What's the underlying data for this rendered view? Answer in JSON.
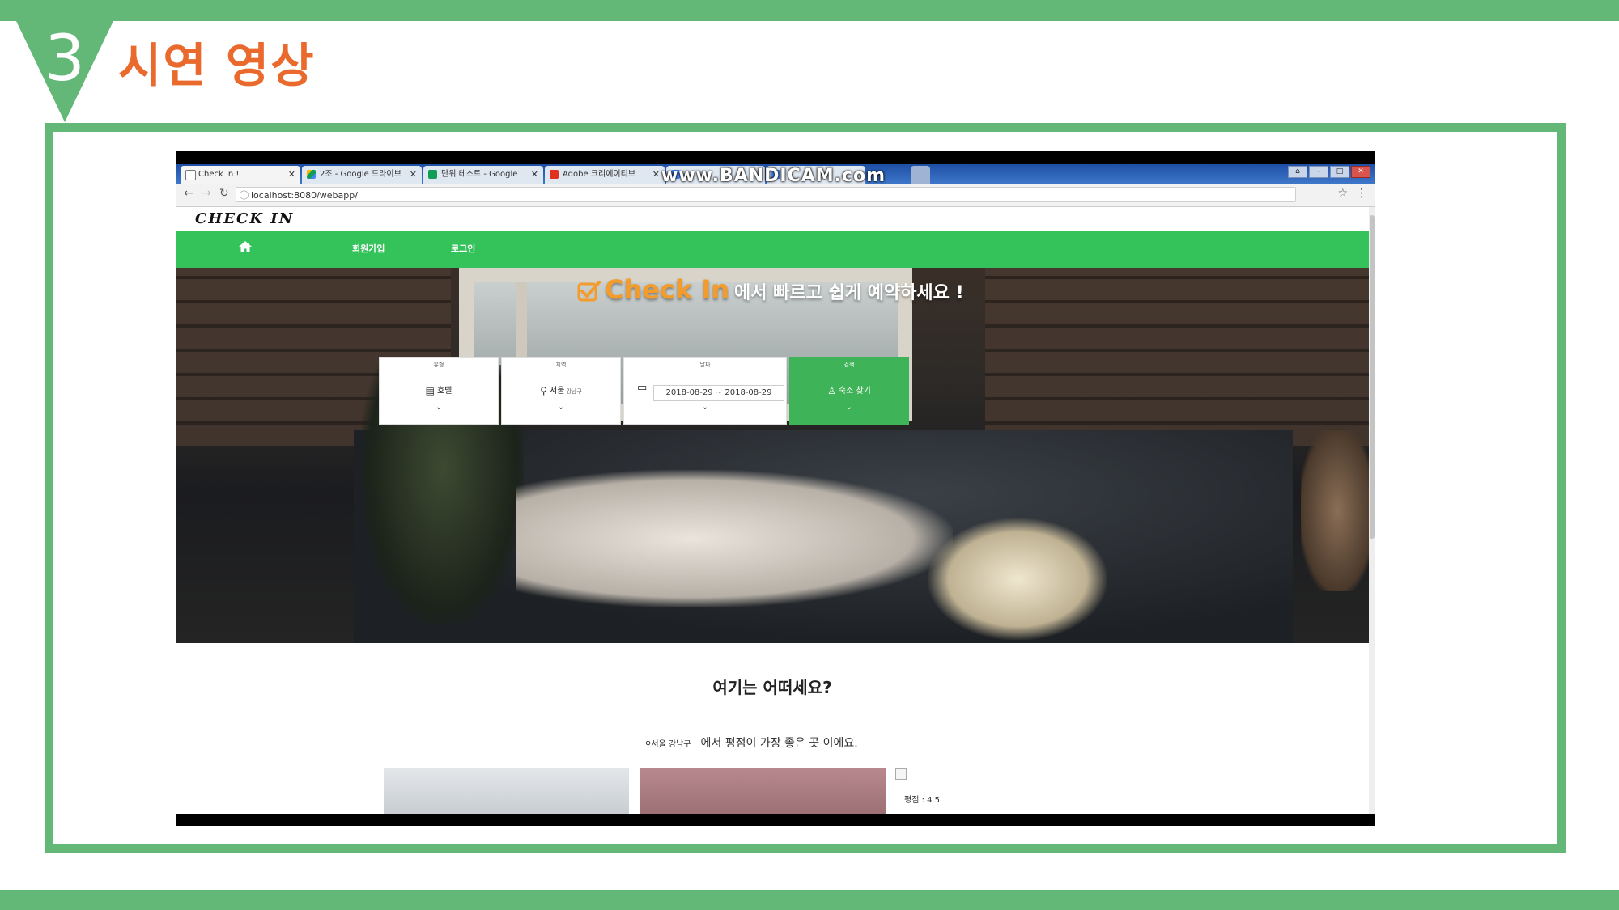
{
  "slide": {
    "number": "3",
    "title": "시연 영상",
    "colors": {
      "accent_green": "#63b877",
      "title_orange": "#ea6a2e"
    }
  },
  "browser": {
    "tabs": [
      {
        "label": "Check In !",
        "favicon": "page-icon"
      },
      {
        "label": "2조 - Google 드라이브",
        "favicon": "google-drive-icon"
      },
      {
        "label": "단위 테스트 - Google",
        "favicon": "google-sheets-icon"
      },
      {
        "label": "Adobe 크리에이티브 ",
        "favicon": "adobe-icon"
      }
    ],
    "url": "localhost:8080/webapp/",
    "watermark": "www.BANDICAM.com"
  },
  "site": {
    "logo": "CHECK IN",
    "nav": {
      "signup": "회원가입",
      "login": "로그인"
    },
    "hero": {
      "brand": "Check In",
      "tagline": "에서 빠르고 쉽게 예약하세요 !"
    },
    "search": {
      "type": {
        "caption": "유형",
        "value": "호텔",
        "icon": "building-icon"
      },
      "region": {
        "caption": "지역",
        "value": "서울",
        "sub": "강남구",
        "icon": "map-pin-icon"
      },
      "date": {
        "caption": "날짜",
        "value": "2018-08-29 ~ 2018-08-29",
        "icon": "calendar-icon"
      },
      "submit": {
        "caption": "검색",
        "label": "숙소 찾기",
        "icon": "person-icon"
      }
    },
    "recommend": {
      "title": "여기는 어떠세요?",
      "location": "서울 강남구",
      "text": "에서 평점이 가장 좋은 곳 이에요.",
      "rating": "평점 : 4.5"
    },
    "colors": {
      "nav_green": "#34c25a",
      "search_green": "#3fb357",
      "brand_orange": "#f39c2b"
    }
  }
}
